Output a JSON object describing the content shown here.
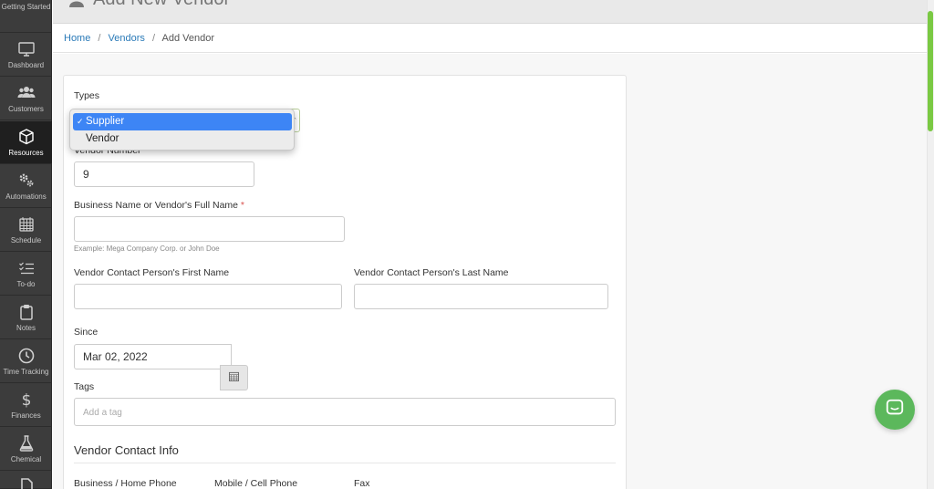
{
  "app": {
    "page_heading": "Add New Vendor"
  },
  "sidebar": {
    "items": [
      {
        "label": "Getting Started",
        "icon": "getting-started-icon"
      },
      {
        "label": "Dashboard",
        "icon": "monitor-icon"
      },
      {
        "label": "Customers",
        "icon": "customers-icon"
      },
      {
        "label": "Resources",
        "icon": "box-icon"
      },
      {
        "label": "Automations",
        "icon": "gears-icon"
      },
      {
        "label": "Schedule",
        "icon": "calendar-icon"
      },
      {
        "label": "To-do",
        "icon": "checklist-icon"
      },
      {
        "label": "Notes",
        "icon": "clipboard-icon"
      },
      {
        "label": "Time Tracking",
        "icon": "clock-icon"
      },
      {
        "label": "Finances",
        "icon": "dollar-icon"
      },
      {
        "label": "Chemical",
        "icon": "flask-icon"
      }
    ],
    "active": "Resources"
  },
  "breadcrumb": {
    "home": "Home",
    "vendors": "Vendors",
    "current": "Add Vendor",
    "separator": "/"
  },
  "form": {
    "types": {
      "label": "Types",
      "options": [
        "Supplier",
        "Vendor"
      ],
      "selected": "Supplier",
      "check_glyph": "✓"
    },
    "vendor_number": {
      "label": "Vendor Number",
      "value": "9"
    },
    "business_name": {
      "label": "Business Name or Vendor's Full Name",
      "required_mark": "*",
      "value": "",
      "help": "Example: Mega Company Corp. or John Doe"
    },
    "contact_first": {
      "label": "Vendor Contact Person's First Name",
      "value": ""
    },
    "contact_last": {
      "label": "Vendor Contact Person's Last Name",
      "value": ""
    },
    "since": {
      "label": "Since",
      "value": "Mar 02, 2022"
    },
    "tags": {
      "label": "Tags",
      "placeholder": "Add a tag"
    },
    "contact_info": {
      "title": "Vendor Contact Info",
      "business_phone_label": "Business / Home Phone",
      "mobile_label": "Mobile / Cell Phone",
      "fax_label": "Fax"
    }
  },
  "colors": {
    "sidebar_bg": "#3c3c3c",
    "link": "#2a7ab8",
    "accent_green": "#5cb85c",
    "selected_option": "#3d85f5"
  }
}
